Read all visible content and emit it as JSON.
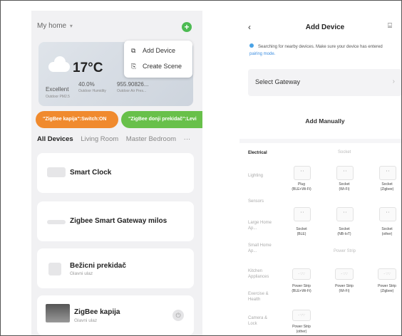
{
  "left": {
    "home_title": "My home",
    "home_caret": "▾",
    "plus": "+",
    "popup": [
      {
        "icon": "⧉",
        "label": "Add Device"
      },
      {
        "icon": "⎘",
        "label": "Create Scene"
      }
    ],
    "weather": {
      "temp": "17°C",
      "excellent": "Excellent",
      "humidity": "40.0%",
      "air": "955.90826...",
      "pm_label": "Outdoor PM2.5",
      "humidity_label": "Outdoor Humidity",
      "air_label": "Outdoor Air Pres..."
    },
    "scenes": [
      "\"ZigBee kapija\":Switch:ON",
      "\"ZigBee donji prekidač\":Levi"
    ],
    "tabs": [
      "All Devices",
      "Living Room",
      "Master Bedroom",
      "···"
    ],
    "devices": [
      {
        "name": "Smart Clock",
        "sub": ""
      },
      {
        "name": "Zigbee Smart Gateway milos",
        "sub": ""
      },
      {
        "name": "Bežicni prekidač",
        "sub": "Glavni ulaz"
      },
      {
        "name": "ZigBee kapija",
        "sub": "Glavni ulaz"
      }
    ],
    "power_icon": "⏻"
  },
  "right": {
    "back": "‹",
    "title": "Add Device",
    "scan_icon": "⌸",
    "searching_text": "Searching for nearby devices. Make sure your device has entered ",
    "pairing_link": "pairing mode.",
    "select_gateway": "Select Gateway",
    "chevron": "›",
    "add_manually": "Add Manually",
    "categories": [
      "Electrical",
      "Lighting",
      "Sensors",
      "Large Home Ap...",
      "Small Home Ap...",
      "Kitchen Appliances",
      "Exercise & Health",
      "Camera & Lock"
    ],
    "section_socket": "Socket",
    "section_powerstrip": "Power Strip",
    "socket_glyph": "ʻ ʼ",
    "strip_glyph": "· ∵∵",
    "sockets": [
      {
        "name": "Plug",
        "sub": "(BLE+Wi-Fi)"
      },
      {
        "name": "Socket",
        "sub": "(Wi-Fi)"
      },
      {
        "name": "Socket",
        "sub": "(Zigbee)"
      },
      {
        "name": "Socket",
        "sub": "(BLE)"
      },
      {
        "name": "Socket",
        "sub": "(NB-IoT)"
      },
      {
        "name": "Socket",
        "sub": "(other)"
      }
    ],
    "strips": [
      {
        "name": "Power Strip",
        "sub": "(BLE+Wi-Fi)"
      },
      {
        "name": "Power Strip",
        "sub": "(Wi-Fi)"
      },
      {
        "name": "Power Strip",
        "sub": "(Zigbee)"
      },
      {
        "name": "Power Strip",
        "sub": "(other)"
      }
    ]
  },
  "colors": {
    "accent_green": "#4dbb53",
    "scene_orange": "#f08a2e",
    "scene_green": "#68c04a",
    "link_blue": "#3b8de0"
  }
}
